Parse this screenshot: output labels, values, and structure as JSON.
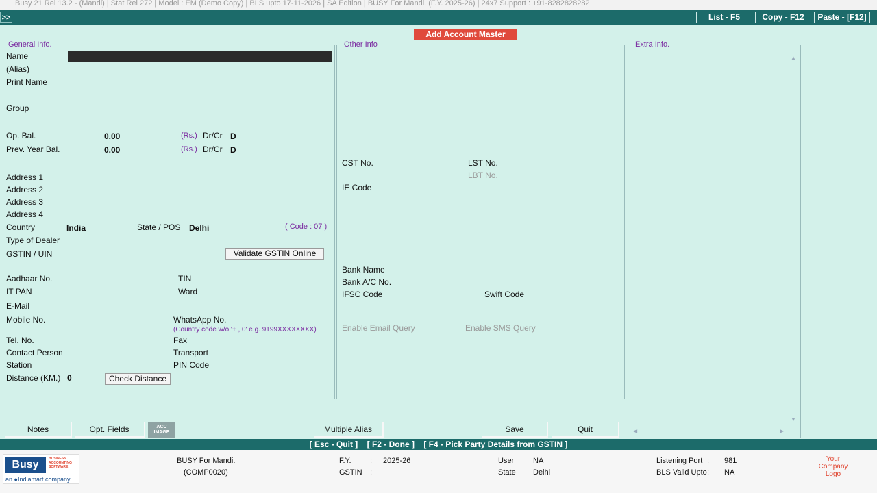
{
  "titlebar": "Busy 21  Rel 13.2 - (Mandi)  |  Stat Rel 272  |  Model : EM (Demo Copy)  |  BLS upto 17-11-2026  |  SA Edition  |  BUSY For Mandi. (F.Y. 2025-26)  |  24x7 Support : +91-8282828282",
  "toolbar": {
    "expand": ">>",
    "list": "List - F5",
    "copy": "Copy - F12",
    "paste": "Paste - [F12]"
  },
  "form_title": "Add Account Master",
  "general": {
    "legend": "General Info.",
    "name": "Name",
    "alias": "(Alias)",
    "print_name": "Print Name",
    "group": "Group",
    "op_bal": "Op. Bal.",
    "op_bal_value": "0.00",
    "prev_bal": "Prev. Year Bal.",
    "prev_bal_value": "0.00",
    "currency": "(Rs.)",
    "drcr": "Dr/Cr",
    "drcr_value": "D",
    "address1": "Address 1",
    "address2": "Address 2",
    "address3": "Address 3",
    "address4": "Address 4",
    "country": "Country",
    "country_value": "India",
    "state": "State / POS",
    "state_value": "Delhi",
    "state_code": "( Code : 07 )",
    "dealer_type": "Type of Dealer",
    "gstin": "GSTIN / UIN",
    "validate_btn": "Validate GSTIN Online",
    "aadhaar": "Aadhaar No.",
    "tin": "TIN",
    "it_pan": "IT PAN",
    "ward": "Ward",
    "email": "E-Mail",
    "mobile": "Mobile No.",
    "whatsapp": "WhatsApp No.",
    "whatsapp_hint": "(Country code w/o '+ , 0' e.g. 9199XXXXXXXX)",
    "tel": "Tel. No.",
    "fax": "Fax",
    "contact": "Contact Person",
    "transport": "Transport",
    "station": "Station",
    "pin": "PIN Code",
    "distance": "Distance (KM.)",
    "distance_value": "0",
    "check_distance_btn": "Check Distance"
  },
  "other": {
    "legend": "Other Info",
    "cst": "CST No.",
    "lst": "LST No.",
    "lbt": "LBT No.",
    "ie_code": "IE Code",
    "bank_name": "Bank Name",
    "bank_ac": "Bank A/C No.",
    "ifsc": "IFSC Code",
    "swift": "Swift Code",
    "email_query": "Enable Email Query",
    "sms_query": "Enable SMS Query"
  },
  "extra": {
    "legend": "Extra Info."
  },
  "buttons": {
    "notes": "Notes",
    "opt_fields": "Opt. Fields",
    "acc_image": "ACC IMAGE",
    "multiple_alias": "Multiple Alias",
    "save": "Save",
    "quit": "Quit"
  },
  "hotkeys": [
    "[ Esc - Quit ]",
    "[ F2 - Done ]",
    "[ F4 - Pick Party Details from GSTIN ]"
  ],
  "status": {
    "logo": "Busy",
    "logo_tagline": "BUSINESS ACCOUNTING SOFTWARE",
    "logo_sub": "an ●Indiamart company",
    "company_name": "BUSY For Mandi.",
    "company_code": "(COMP0020)",
    "fy_label": "F.Y.",
    "fy_sep": ":",
    "fy_value": "2025-26",
    "gstin_label": "GSTIN",
    "gstin_sep": ":",
    "user_label": "User",
    "user_value": "NA",
    "state_label": "State",
    "state_value": "Delhi",
    "port_label": "Listening Port",
    "port_sep": ":",
    "port_value": "981",
    "bls_label": "BLS Valid Upto",
    "bls_sep": ":",
    "bls_value": "NA",
    "company_logo": "Your Company Logo"
  }
}
